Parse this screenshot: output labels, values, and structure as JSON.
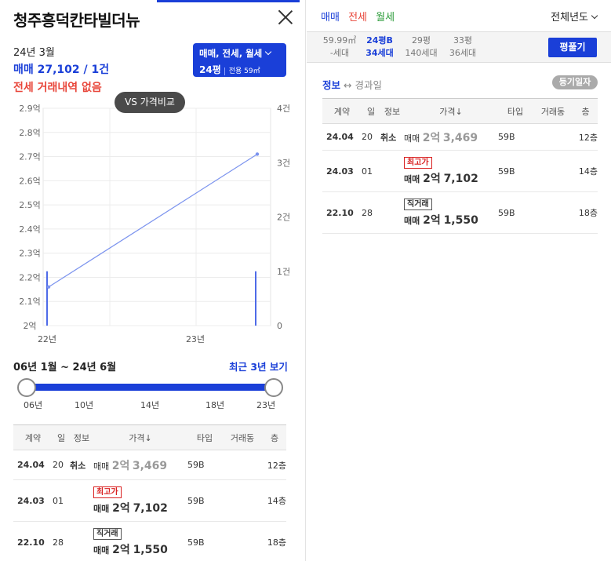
{
  "header": {
    "title": "청주흥덕칸타빌더뉴"
  },
  "summary": {
    "month": "24년 3월",
    "sale": "매매 27,102 / 1건",
    "jeonse": "전세 거래내역 없음"
  },
  "selector": {
    "line1": "매매, 전세, 월세",
    "pyeong": "24평",
    "exclusive": "전용 59㎡"
  },
  "compare_button": "VS 가격비교",
  "chart_data": {
    "type": "line",
    "x": [
      "22년 초",
      "24년 3월"
    ],
    "series": [
      {
        "values": [
          2.16,
          2.71
        ]
      }
    ],
    "bars": {
      "values": [
        1,
        1
      ]
    },
    "y_left": {
      "ticks": [
        "2.9억",
        "2.8억",
        "2.7억",
        "2.6억",
        "2.5억",
        "2.4억",
        "2.3억",
        "2.2억",
        "2.1억",
        "2억"
      ],
      "ylim": [
        2.0,
        2.9
      ]
    },
    "y_right": {
      "ticks": [
        "4건",
        "3건",
        "2건",
        "1건",
        "0"
      ],
      "ylim": [
        0,
        4
      ]
    },
    "x_ticks": [
      "22년",
      "23년"
    ],
    "grid": true,
    "line_color": "#7b93ee",
    "bar_color": "#4f6be8"
  },
  "range": {
    "label": "06년 1월 ~ 24년 6월",
    "recent_label": "최근 3년 보기",
    "ticks": [
      "06년",
      "10년",
      "14년",
      "18년",
      "23년"
    ]
  },
  "table": {
    "headers": [
      "계약",
      "일",
      "정보",
      "가격↓",
      "타입",
      "거래동",
      "층"
    ],
    "rows": [
      {
        "date": "24.04",
        "day": "20",
        "info": "취소",
        "tag": "",
        "kind": "매매",
        "price_main": "2억",
        "price_sub": "3,469",
        "type": "59B",
        "dong": "",
        "floor": "12층",
        "style": "grey"
      },
      {
        "date": "24.03",
        "day": "01",
        "info": "",
        "tag": "최고가",
        "kind": "매매",
        "price_main": "2억",
        "price_sub": "7,102",
        "type": "59B",
        "dong": "",
        "floor": "14층",
        "style": "blue",
        "tag_style": "red"
      },
      {
        "date": "22.10",
        "day": "28",
        "info": "",
        "tag": "직거래",
        "kind": "매매",
        "price_main": "2억",
        "price_sub": "1,550",
        "type": "59B",
        "dong": "",
        "floor": "18층",
        "style": "blue",
        "tag_style": "grey"
      }
    ]
  },
  "right": {
    "tabs": [
      {
        "label": "매매",
        "color": "#1a3fd8"
      },
      {
        "label": "전세",
        "color": "#e8463a"
      },
      {
        "label": "월세",
        "color": "#2c9c3a"
      }
    ],
    "year_filter": "전체년도",
    "areas": [
      {
        "top": "59.99㎡",
        "bottom": "-세대",
        "selected": false
      },
      {
        "top": "24평B",
        "bottom": "34세대",
        "selected": true
      },
      {
        "top": "29평",
        "bottom": "140세대",
        "selected": false
      },
      {
        "top": "33평",
        "bottom": "36세대",
        "selected": false
      }
    ],
    "pyeong_button": "평풀기",
    "info_a": "정보",
    "info_arrow": "↔",
    "info_b": "경과일",
    "registration_button": "등기일자"
  }
}
